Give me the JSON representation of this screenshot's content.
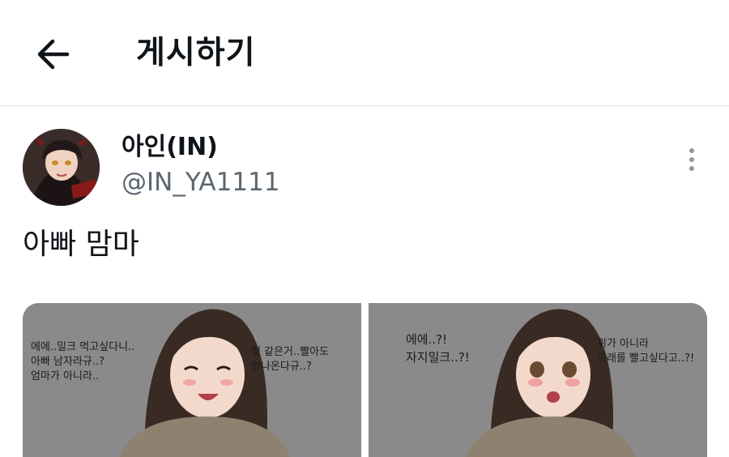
{
  "header": {
    "title": "게시하기",
    "back_icon": "arrow-left-icon"
  },
  "author": {
    "display_name": "아인(IN)",
    "handle": "@IN_YA1111",
    "more_icon": "more-vertical-icon"
  },
  "post": {
    "text": "아빠 맘마",
    "images": [
      {
        "bubbles": [
          {
            "lines": [
              "에에..밀크 먹고싶다니..",
              "아빠 남자라규..?",
              "엄마가 아니라.."
            ]
          },
          {
            "lines": [
              "젖 같은거..빨아도",
              "안나온다규..?"
            ]
          }
        ]
      },
      {
        "bubbles": [
          {
            "lines": [
              "에에..?!",
              "자지밀크..?!"
            ]
          },
          {
            "lines": [
              "위가 아니라",
              "아래를 빨고싶다고..?!"
            ]
          }
        ]
      }
    ]
  },
  "colors": {
    "text": "#0f1419",
    "secondary": "#5b6670",
    "divider": "#e3e6e8",
    "image_bg": "#8a8a8a"
  }
}
